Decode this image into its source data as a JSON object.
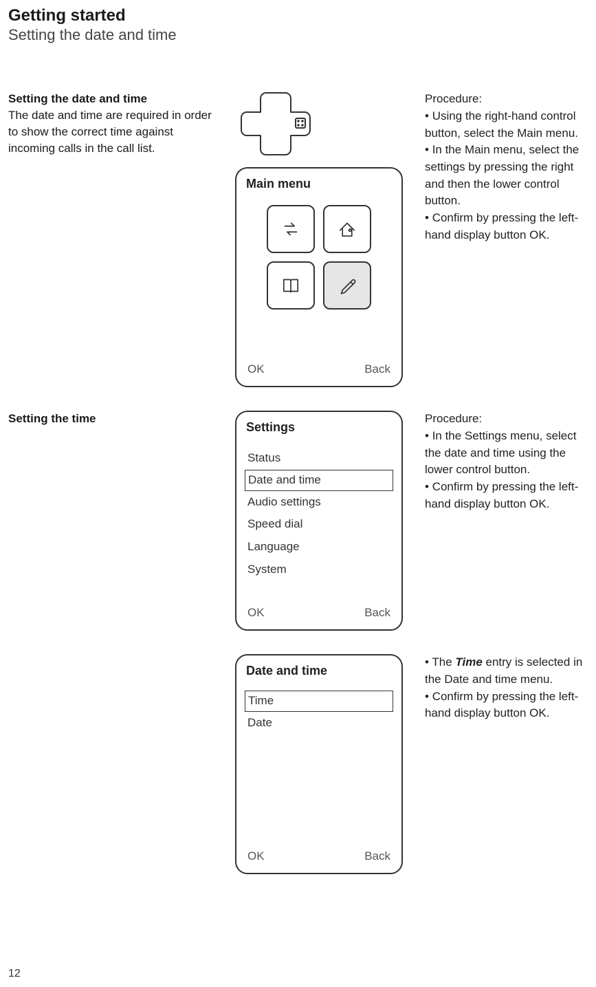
{
  "header": {
    "title": "Getting started",
    "subtitle": "Setting the date and time"
  },
  "page_number": "12",
  "sections": [
    {
      "left_title": "Setting the date and time",
      "left_body": "The date and time are required in order to show the correct time against incoming calls in the call list.",
      "screen": {
        "title": "Main menu",
        "ok": "OK",
        "back": "Back"
      },
      "right_title": "Procedure:",
      "right_bullets": [
        "Using the right-hand control button, select the Main menu.",
        "In the Main menu, select the settings by pressing the right and then the lower control button.",
        "Confirm by pressing the left-hand display button OK."
      ]
    },
    {
      "left_title": "Setting the time",
      "screen": {
        "title": "Settings",
        "items": [
          "Status",
          "Date and time",
          "Audio settings",
          "Speed dial",
          "Language",
          "System"
        ],
        "selected_index": 1,
        "ok": "OK",
        "back": "Back"
      },
      "right_title": "Procedure:",
      "right_bullets": [
        "In the Settings menu, select the date and time using the lower control button.",
        "Confirm by pressing the left-hand display button OK."
      ]
    },
    {
      "screen": {
        "title": "Date and time",
        "items": [
          "Time",
          "Date"
        ],
        "selected_index": 0,
        "ok": "OK",
        "back": "Back"
      },
      "right_bullets": [
        {
          "pre": "The ",
          "em": "Time",
          "post": " entry is selected in the Date and time menu."
        },
        "Confirm by pressing the left-hand display button OK."
      ]
    }
  ]
}
